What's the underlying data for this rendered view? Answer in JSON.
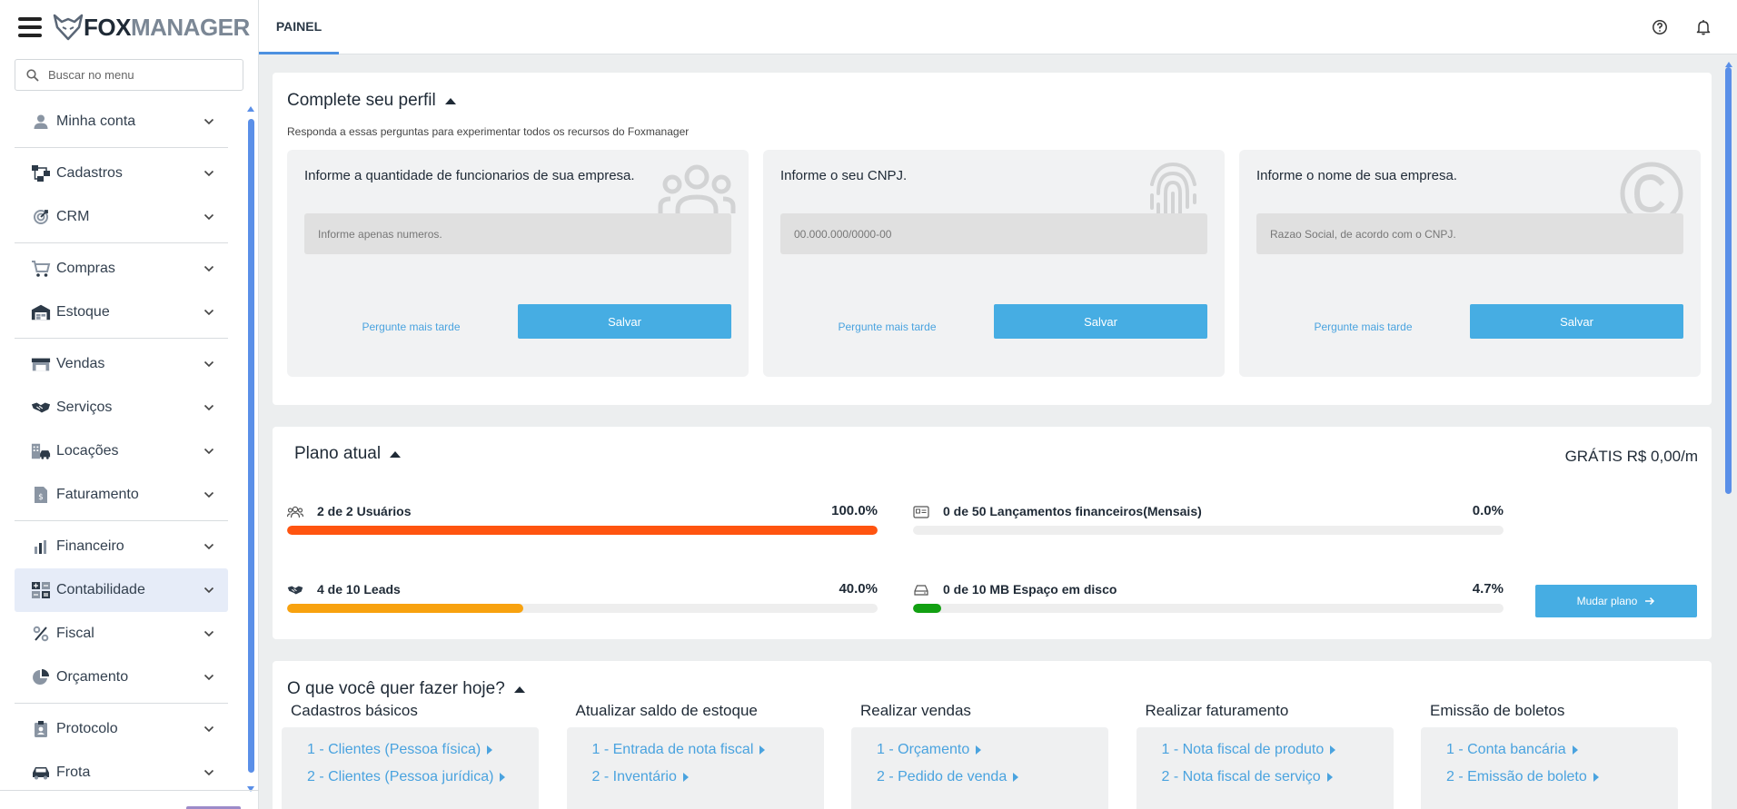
{
  "app": {
    "logo_fox": "FOX",
    "logo_manager": "MANAGER"
  },
  "sidebar": {
    "search_placeholder": "Buscar no menu",
    "items": [
      {
        "label": "Minha conta",
        "icon": "user-icon"
      },
      {
        "label": "Cadastros",
        "icon": "hierarchy-icon"
      },
      {
        "label": "CRM",
        "icon": "target-icon"
      },
      {
        "label": "Compras",
        "icon": "cart-icon"
      },
      {
        "label": "Estoque",
        "icon": "warehouse-icon"
      },
      {
        "label": "Vendas",
        "icon": "storefront-icon"
      },
      {
        "label": "Serviços",
        "icon": "handshake-icon"
      },
      {
        "label": "Locações",
        "icon": "building-car-icon"
      },
      {
        "label": "Faturamento",
        "icon": "invoice-icon"
      },
      {
        "label": "Financeiro",
        "icon": "bar-chart-icon"
      },
      {
        "label": "Contabilidade",
        "icon": "calculator-icon"
      },
      {
        "label": "Fiscal",
        "icon": "percent-icon"
      },
      {
        "label": "Orçamento",
        "icon": "pie-chart-icon"
      },
      {
        "label": "Protocolo",
        "icon": "badge-icon"
      },
      {
        "label": "Frota",
        "icon": "car-icon"
      }
    ]
  },
  "topbar": {
    "tab_label": "PAINEL"
  },
  "profile": {
    "title": "Complete seu perfil",
    "subtitle": "Responda a essas perguntas para experimentar todos os recursos do Foxmanager",
    "boxes": [
      {
        "question": "Informe a quantidade de funcionarios de sua empresa.",
        "placeholder": "Informe apenas numeros.",
        "later": "Pergunte mais tarde",
        "save": "Salvar",
        "bg_icon": "users-icon"
      },
      {
        "question": "Informe o seu CNPJ.",
        "placeholder": "00.000.000/0000-00",
        "later": "Pergunte mais tarde",
        "save": "Salvar",
        "bg_icon": "fingerprint-icon"
      },
      {
        "question": "Informe o nome de sua empresa.",
        "placeholder": "Razao Social, de acordo com o CNPJ.",
        "later": "Pergunte mais tarde",
        "save": "Salvar",
        "bg_icon": "copyright-icon"
      }
    ]
  },
  "plan": {
    "title": "Plano atual",
    "price": "GRÁTIS R$ 0,00/m",
    "button": "Mudar plano",
    "quotas": [
      {
        "label": "2 de 2 Usuários",
        "percent_label": "100.0%",
        "percent": 100,
        "color": "#ff5410",
        "icon": "users-icon"
      },
      {
        "label": "0 de 50 Lançamentos financeiros(Mensais)",
        "percent_label": "0.0%",
        "percent": 0,
        "color": "#ff5410",
        "icon": "id-card-icon"
      },
      {
        "label": "4 de 10 Leads",
        "percent_label": "40.0%",
        "percent": 40,
        "color": "#f8a20f",
        "icon": "handshake-icon"
      },
      {
        "label": "0 de 10 MB Espaço em disco",
        "percent_label": "4.7%",
        "percent": 4.7,
        "color": "#12a012",
        "icon": "hard-drive-icon"
      }
    ]
  },
  "todo": {
    "title": "O que você quer fazer hoje?",
    "columns": [
      {
        "title": "Cadastros básicos",
        "links": [
          "1 - Clientes (Pessoa física)",
          "2 - Clientes (Pessoa jurídica)"
        ]
      },
      {
        "title": "Atualizar saldo de estoque",
        "links": [
          "1 - Entrada de nota fiscal",
          "2 - Inventário"
        ]
      },
      {
        "title": "Realizar vendas",
        "links": [
          "1 - Orçamento",
          "2 - Pedido de venda"
        ]
      },
      {
        "title": "Realizar faturamento",
        "links": [
          "1 - Nota fiscal de produto",
          "2 - Nota fiscal de serviço"
        ]
      },
      {
        "title": "Emissão de boletos",
        "links": [
          "1 - Conta bancária",
          "2 - Emissão de boleto"
        ]
      }
    ]
  },
  "colors": {
    "accent": "#46ade3",
    "scrollbar": "#5a8fe8",
    "link": "#4aa3df"
  }
}
